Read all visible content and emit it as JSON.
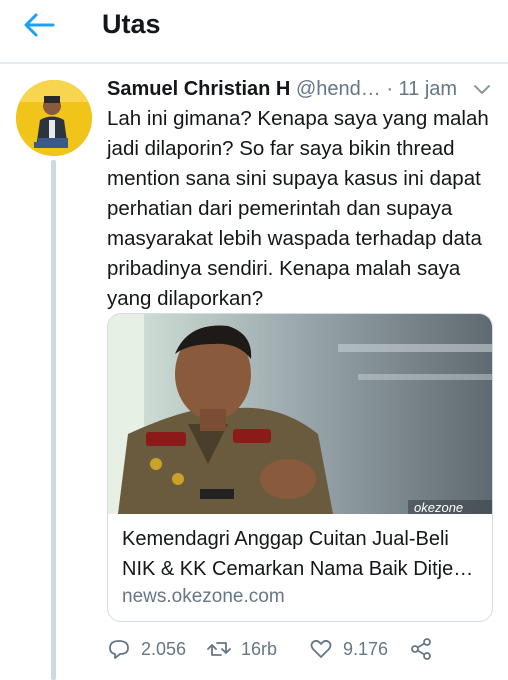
{
  "header": {
    "title": "Utas",
    "back_icon": "arrow-left-icon"
  },
  "colors": {
    "accent": "#1da1f2",
    "text": "#14171a",
    "muted": "#657786",
    "avatar_bg": "#f0c419"
  },
  "tweet": {
    "display_name": "Samuel Christian H",
    "handle": "@hend…",
    "separator": "·",
    "time": "11 jam",
    "text": "Lah ini gimana? Kenapa saya yang malah jadi dilaporin? So far saya bikin thread mention sana sini supaya kasus ini dapat perhatian dari pemerintah dan supaya masyarakat lebih waspada terhadap data pribadinya sendiri. Kenapa malah saya yang dilaporkan?",
    "card": {
      "title": "Kemendagri Anggap Cuitan Jual-Beli NIK & KK Cemarkan Nama Baik Ditje…",
      "domain": "news.okezone.com",
      "watermark": "okezone"
    },
    "actions": {
      "replies": "2.056",
      "retweets": "16rb",
      "likes": "9.176"
    }
  }
}
